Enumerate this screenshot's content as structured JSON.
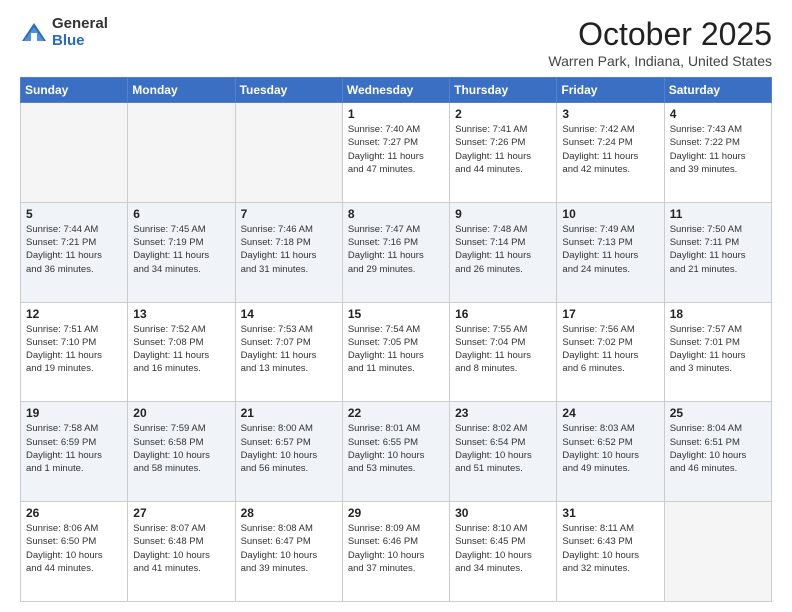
{
  "logo": {
    "general": "General",
    "blue": "Blue"
  },
  "header": {
    "month": "October 2025",
    "location": "Warren Park, Indiana, United States"
  },
  "weekdays": [
    "Sunday",
    "Monday",
    "Tuesday",
    "Wednesday",
    "Thursday",
    "Friday",
    "Saturday"
  ],
  "weeks": [
    [
      {
        "day": "",
        "info": ""
      },
      {
        "day": "",
        "info": ""
      },
      {
        "day": "",
        "info": ""
      },
      {
        "day": "1",
        "info": "Sunrise: 7:40 AM\nSunset: 7:27 PM\nDaylight: 11 hours\nand 47 minutes."
      },
      {
        "day": "2",
        "info": "Sunrise: 7:41 AM\nSunset: 7:26 PM\nDaylight: 11 hours\nand 44 minutes."
      },
      {
        "day": "3",
        "info": "Sunrise: 7:42 AM\nSunset: 7:24 PM\nDaylight: 11 hours\nand 42 minutes."
      },
      {
        "day": "4",
        "info": "Sunrise: 7:43 AM\nSunset: 7:22 PM\nDaylight: 11 hours\nand 39 minutes."
      }
    ],
    [
      {
        "day": "5",
        "info": "Sunrise: 7:44 AM\nSunset: 7:21 PM\nDaylight: 11 hours\nand 36 minutes."
      },
      {
        "day": "6",
        "info": "Sunrise: 7:45 AM\nSunset: 7:19 PM\nDaylight: 11 hours\nand 34 minutes."
      },
      {
        "day": "7",
        "info": "Sunrise: 7:46 AM\nSunset: 7:18 PM\nDaylight: 11 hours\nand 31 minutes."
      },
      {
        "day": "8",
        "info": "Sunrise: 7:47 AM\nSunset: 7:16 PM\nDaylight: 11 hours\nand 29 minutes."
      },
      {
        "day": "9",
        "info": "Sunrise: 7:48 AM\nSunset: 7:14 PM\nDaylight: 11 hours\nand 26 minutes."
      },
      {
        "day": "10",
        "info": "Sunrise: 7:49 AM\nSunset: 7:13 PM\nDaylight: 11 hours\nand 24 minutes."
      },
      {
        "day": "11",
        "info": "Sunrise: 7:50 AM\nSunset: 7:11 PM\nDaylight: 11 hours\nand 21 minutes."
      }
    ],
    [
      {
        "day": "12",
        "info": "Sunrise: 7:51 AM\nSunset: 7:10 PM\nDaylight: 11 hours\nand 19 minutes."
      },
      {
        "day": "13",
        "info": "Sunrise: 7:52 AM\nSunset: 7:08 PM\nDaylight: 11 hours\nand 16 minutes."
      },
      {
        "day": "14",
        "info": "Sunrise: 7:53 AM\nSunset: 7:07 PM\nDaylight: 11 hours\nand 13 minutes."
      },
      {
        "day": "15",
        "info": "Sunrise: 7:54 AM\nSunset: 7:05 PM\nDaylight: 11 hours\nand 11 minutes."
      },
      {
        "day": "16",
        "info": "Sunrise: 7:55 AM\nSunset: 7:04 PM\nDaylight: 11 hours\nand 8 minutes."
      },
      {
        "day": "17",
        "info": "Sunrise: 7:56 AM\nSunset: 7:02 PM\nDaylight: 11 hours\nand 6 minutes."
      },
      {
        "day": "18",
        "info": "Sunrise: 7:57 AM\nSunset: 7:01 PM\nDaylight: 11 hours\nand 3 minutes."
      }
    ],
    [
      {
        "day": "19",
        "info": "Sunrise: 7:58 AM\nSunset: 6:59 PM\nDaylight: 11 hours\nand 1 minute."
      },
      {
        "day": "20",
        "info": "Sunrise: 7:59 AM\nSunset: 6:58 PM\nDaylight: 10 hours\nand 58 minutes."
      },
      {
        "day": "21",
        "info": "Sunrise: 8:00 AM\nSunset: 6:57 PM\nDaylight: 10 hours\nand 56 minutes."
      },
      {
        "day": "22",
        "info": "Sunrise: 8:01 AM\nSunset: 6:55 PM\nDaylight: 10 hours\nand 53 minutes."
      },
      {
        "day": "23",
        "info": "Sunrise: 8:02 AM\nSunset: 6:54 PM\nDaylight: 10 hours\nand 51 minutes."
      },
      {
        "day": "24",
        "info": "Sunrise: 8:03 AM\nSunset: 6:52 PM\nDaylight: 10 hours\nand 49 minutes."
      },
      {
        "day": "25",
        "info": "Sunrise: 8:04 AM\nSunset: 6:51 PM\nDaylight: 10 hours\nand 46 minutes."
      }
    ],
    [
      {
        "day": "26",
        "info": "Sunrise: 8:06 AM\nSunset: 6:50 PM\nDaylight: 10 hours\nand 44 minutes."
      },
      {
        "day": "27",
        "info": "Sunrise: 8:07 AM\nSunset: 6:48 PM\nDaylight: 10 hours\nand 41 minutes."
      },
      {
        "day": "28",
        "info": "Sunrise: 8:08 AM\nSunset: 6:47 PM\nDaylight: 10 hours\nand 39 minutes."
      },
      {
        "day": "29",
        "info": "Sunrise: 8:09 AM\nSunset: 6:46 PM\nDaylight: 10 hours\nand 37 minutes."
      },
      {
        "day": "30",
        "info": "Sunrise: 8:10 AM\nSunset: 6:45 PM\nDaylight: 10 hours\nand 34 minutes."
      },
      {
        "day": "31",
        "info": "Sunrise: 8:11 AM\nSunset: 6:43 PM\nDaylight: 10 hours\nand 32 minutes."
      },
      {
        "day": "",
        "info": ""
      }
    ]
  ]
}
